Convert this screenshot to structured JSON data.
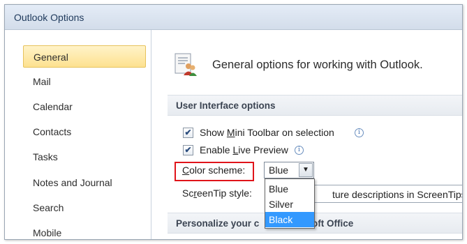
{
  "window": {
    "title": "Outlook Options"
  },
  "sidebar": {
    "items": [
      {
        "label": "General",
        "selected": true
      },
      {
        "label": "Mail"
      },
      {
        "label": "Calendar"
      },
      {
        "label": "Contacts"
      },
      {
        "label": "Tasks"
      },
      {
        "label": "Notes and Journal"
      },
      {
        "label": "Search"
      },
      {
        "label": "Mobile"
      }
    ]
  },
  "header": {
    "title": "General options for working with Outlook.",
    "icon": "general-options-icon"
  },
  "ui_options": {
    "section_title": "User Interface options",
    "show_mini_toolbar": {
      "label_pre": "Show ",
      "label_key": "M",
      "label_post": "ini Toolbar on selection",
      "checked": true
    },
    "enable_live_preview": {
      "label_pre": "Enable ",
      "label_key": "L",
      "label_post": "ive Preview",
      "checked": true
    },
    "color_scheme": {
      "label_key": "C",
      "label_post": "olor scheme:",
      "value": "Blue",
      "options": [
        "Blue",
        "Silver",
        "Black"
      ],
      "highlighted_option": "Black"
    },
    "screentip": {
      "label_pre": "Sc",
      "label_key": "r",
      "label_post": "eenTip style:",
      "value_fragment": "ture descriptions in ScreenTips"
    }
  },
  "personalize": {
    "title_left": "Personalize your c",
    "title_right": "rosoft Office"
  },
  "colors": {
    "accent_red": "#e0141a",
    "selected_nav": "#fde18f",
    "dropdown_highlight": "#3399ff"
  }
}
